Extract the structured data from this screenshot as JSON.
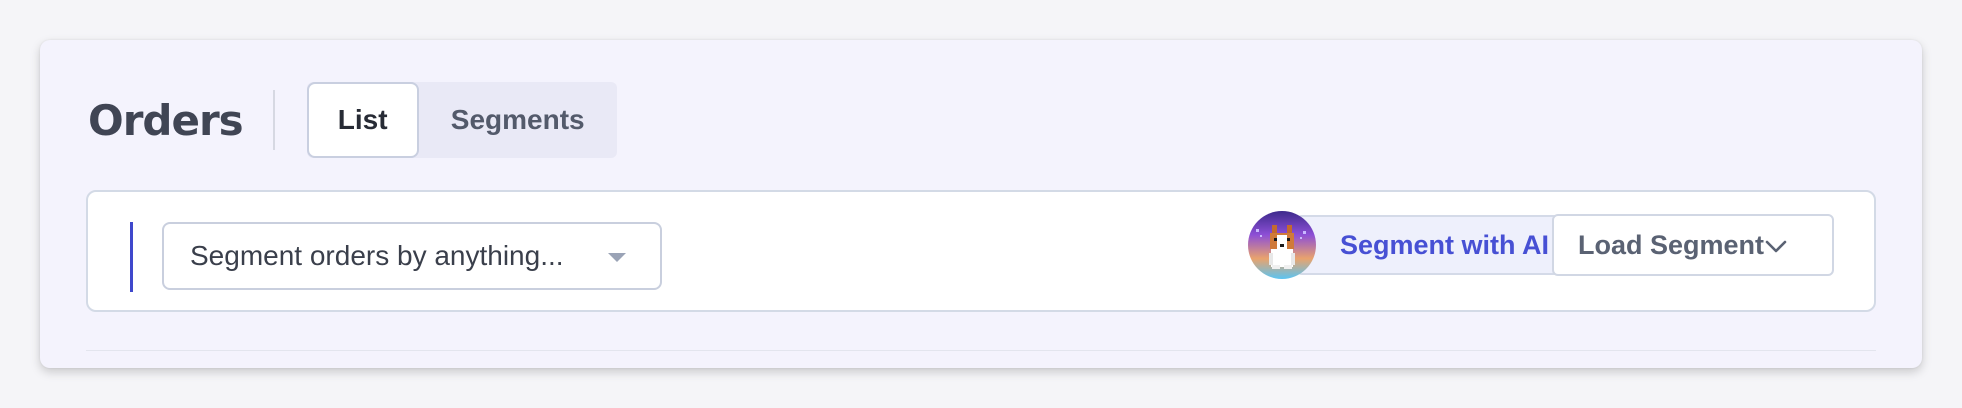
{
  "header": {
    "title": "Orders",
    "tabs": [
      {
        "label": "List",
        "active": true
      },
      {
        "label": "Segments",
        "active": false
      }
    ]
  },
  "toolbar": {
    "segment_select": {
      "placeholder": "Segment orders by anything..."
    },
    "ai_button": {
      "label": "Segment with AI",
      "avatar_icon": "corgi-avatar-icon"
    },
    "load_button": {
      "label": "Load Segment",
      "icon": "chevron-down-icon"
    }
  },
  "colors": {
    "accent": "#4750d4",
    "card_background": "#f4f3fd",
    "title_text": "#404554"
  }
}
